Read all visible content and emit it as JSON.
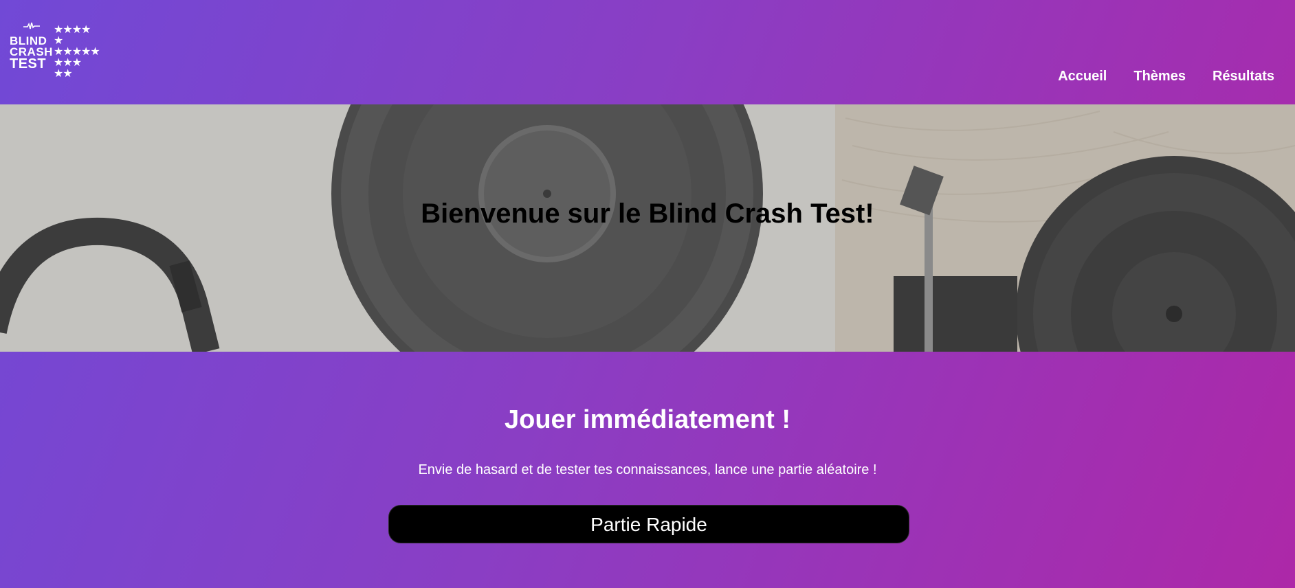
{
  "logo": {
    "line1": "BLIND",
    "line2": "CRASH",
    "line3": "TEST",
    "icon": "soundwave-icon"
  },
  "nav": {
    "items": [
      {
        "label": "Accueil"
      },
      {
        "label": "Thèmes"
      },
      {
        "label": "Résultats"
      }
    ]
  },
  "hero": {
    "title": "Bienvenue sur le Blind Crash Test!"
  },
  "quick_play": {
    "title": "Jouer immédiatement !",
    "description": "Envie de hasard et de tester tes connaissances, lance une partie aléatoire !",
    "button_label": "Partie Rapide"
  },
  "colors": {
    "gradient_start": "#7149d6",
    "gradient_end": "#ad28a8",
    "button_bg": "#000000",
    "text_light": "#ffffff"
  }
}
